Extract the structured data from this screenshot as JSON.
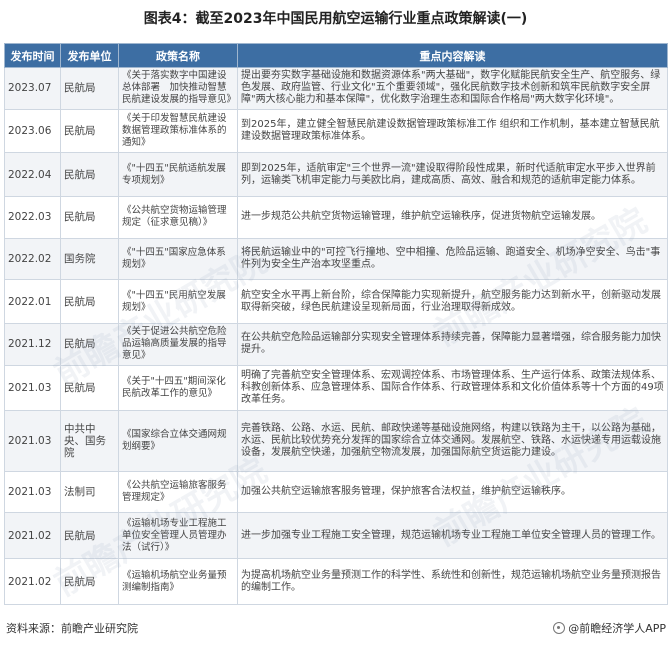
{
  "title": "图表4：截至2023年中国民用航空运输行业重点政策解读(一)",
  "columns": [
    "发布时间",
    "发布单位",
    "政策名称",
    "重点内容解读"
  ],
  "rows": [
    {
      "date": "2023.07",
      "unit": "民航局",
      "name": "《关于落实数字中国建设总体部署　加快推动智慧民航建设发展的指导意见》",
      "content": "提出要夯实数字基础设施和数据资源体系\"两大基础\"，数字化赋能民航安全生产、航空服务、绿色发展、政府监管、行业文化\"五个重要领域\"，强化民航数字技术创新和筑牢民航数字安全屏障\"两大核心能力和基本保障\"，优化数字治理生态和国际合作格局\"两大数字化环境\"。"
    },
    {
      "date": "2023.06",
      "unit": "民航局",
      "name": "《关于印发智慧民航建设数据管理政策标准体系的通知》",
      "content": "到2025年，建立健全智慧民航建设数据管理政策标准工作 组织和工作机制，基本建立智慧民航建设数据管理政策标准体系。"
    },
    {
      "date": "2022.04",
      "unit": "民航局",
      "name": "《\"十四五\"民航适航发展专项规划》",
      "content": "即到2025年，适航审定\"三个世界一流\"建设取得阶段性成果，新时代适航审定水平步入世界前列，运输类飞机审定能力与美欧比肩，建成高质、高效、融合和规范的适航审定能力体系。"
    },
    {
      "date": "2022.03",
      "unit": "民航局",
      "name": "《公共航空货物运输管理规定（征求意见稿）》",
      "content": "进一步规范公共航空货物运输管理，维护航空运输秩序，促进货物航空运输发展。"
    },
    {
      "date": "2022.02",
      "unit": "国务院",
      "name": "《\"十四五\"国家应急体系规划》",
      "content": "将民航运输业中的\"可控飞行撞地、空中相撞、危险品运输、跑道安全、机场净空安全、鸟击\"事件列为安全生产治本攻坚重点。"
    },
    {
      "date": "2022.01",
      "unit": "民航局",
      "name": "《\"十四五\"民用航空发展规划》",
      "content": "航空安全水平再上新台阶，综合保障能力实现新提升，航空服务能力达到新水平，创新驱动发展取得新突破，绿色民航建设呈现新局面，行业治理取得新成效。"
    },
    {
      "date": "2021.12",
      "unit": "民航局",
      "name": "《关于促进公共航空危险品运输高质量发展的指导意见》",
      "content": "在公共航空危险品运输部分实现安全管理体系持续完善，保障能力显著增强，综合服务能力加快提升。"
    },
    {
      "date": "2021.03",
      "unit": "民航局",
      "name": "《关于\"十四五\"期间深化民航改革工作的意见》",
      "content": "明确了完善航空安全管理体系、宏观调控体系、市场管理体系、生产运行体系、政策法规体系、科教创新体系、应急管理体系、国际合作体系、行政管理体系和文化价值体系等十个方面的49项改革任务。"
    },
    {
      "date": "2021.03",
      "unit": "中共中央、国务院",
      "name": "《国家综合立体交通网规划纲要》",
      "content": "完善铁路、公路、水运、民航、邮政快递等基础设施网络，构建以铁路为主干，以公路为基础，水运、民航比较优势充分发挥的国家综合立体交通网。发展航空、铁路、水运快递专用运载设施设备，发展航空快递，加强航空物流发展，加强国际航空货运能力建设。"
    },
    {
      "date": "2021.03",
      "unit": "法制司",
      "name": "《公共航空运输旅客服务管理规定》",
      "content": "加强公共航空运输旅客服务管理，保护旅客合法权益，维护航空运输秩序。"
    },
    {
      "date": "2021.02",
      "unit": "民航局",
      "name": "《运输机场专业工程施工单位安全管理人员管理办法（试行）》",
      "content": "进一步加强专业工程施工安全管理，规范运输机场专业工程施工单位安全管理人员的管理工作。"
    },
    {
      "date": "2021.02",
      "unit": "民航局",
      "name": "《运输机场航空业务量预测编制指南》",
      "content": "为提高机场航空业务量预测工作的科学性、系统性和创新性，规范运输机场航空业务量预测报告的编制工作。"
    }
  ],
  "footer": {
    "source": "资料来源：前瞻产业研究院",
    "brand": "@前瞻经济学人APP"
  },
  "watermark": "前瞻产业研究院"
}
